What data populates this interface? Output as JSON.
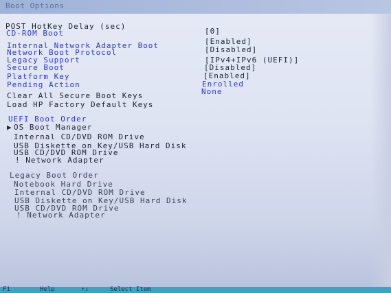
{
  "title": "Boot Options",
  "settings": [
    {
      "label": "POST HotKey Delay (sec)",
      "value": "[0]"
    },
    {
      "label": "CD-ROM Boot",
      "value": "[Enabled]"
    },
    {
      "label": "Internal Network Adapter Boot",
      "value": "[Disabled]"
    },
    {
      "label": "Network Boot Protocol",
      "value": "[IPv4+IPv6 (UEFI)]"
    },
    {
      "label": "Legacy Support",
      "value": "[Disabled]"
    },
    {
      "label": "Secure Boot",
      "value": "[Enabled]"
    },
    {
      "label": "Platform Key",
      "value": "Enrolled"
    },
    {
      "label": "Pending Action",
      "value": "None"
    },
    {
      "label": "Clear All Secure Boot Keys"
    },
    {
      "label": "Load HP Factory Default Keys"
    }
  ],
  "uefi_order": {
    "heading": "UEFI Boot Order",
    "marker": "▶",
    "items": [
      "OS Boot Manager",
      "Internal CD/DVD ROM Drive",
      "USB Diskette on Key/USB Hard Disk",
      "USB CD/DVD ROM Drive",
      "! Network Adapter"
    ]
  },
  "legacy_order": {
    "heading": "Legacy Boot Order",
    "items": [
      "Notebook Hard Drive",
      "Internal CD/DVD ROM Drive",
      "USB Diskette on Key/USB Hard Disk",
      "USB CD/DVD ROM Drive",
      "! Network Adapter"
    ]
  },
  "footer": {
    "keys": [
      {
        "key": "F1",
        "label": "Help"
      },
      {
        "key": "↑↓",
        "label": "Select Item"
      }
    ]
  }
}
